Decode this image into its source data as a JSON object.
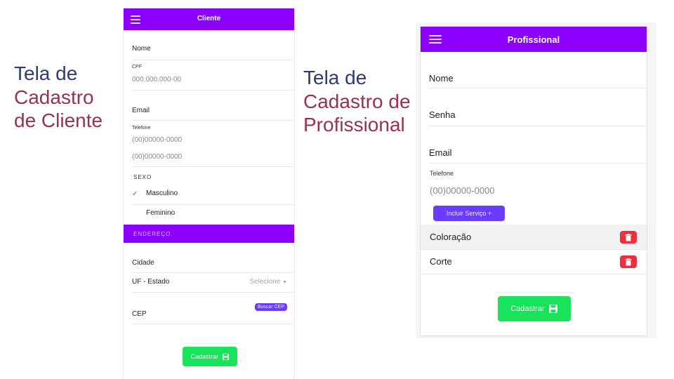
{
  "captions": {
    "cliente": [
      "Tela de",
      "Cadastro",
      "de Cliente"
    ],
    "profissional": [
      "Tela de",
      "Cadastro de",
      "Profissional"
    ]
  },
  "cliente": {
    "title": "Cliente",
    "nome_label": "Nome",
    "cpf_label": "CPF",
    "cpf_placeholder": "000.000.000-00",
    "email_label": "Email",
    "telefone_label": "Telefone",
    "telefone_placeholder_1": "(00)00000-0000",
    "telefone_placeholder_2": "(00)00000-0000",
    "sexo_label": "SEXO",
    "sexo_options": [
      "Masculino",
      "Feminino"
    ],
    "sexo_selected": "Masculino",
    "endereco_label": "ENDEREÇO",
    "cidade_label": "Cidade",
    "uf_label": "UF - Estado",
    "uf_select": "Selecione",
    "cep_label": "CEP",
    "buscar_cep": "Buscar CEP",
    "cadastrar": "Cadastrar"
  },
  "profissional": {
    "title": "Profissional",
    "nome_label": "Nome",
    "senha_label": "Senha",
    "email_label": "Email",
    "telefone_label": "Telefone",
    "telefone_placeholder": "(00)00000-0000",
    "incluir_servico": "Incluir Serviço +",
    "servicos": [
      "Coloração",
      "Corte"
    ],
    "cadastrar": "Cadastrar"
  },
  "colors": {
    "appbar": "#8b00ff",
    "primary_button": "#19e35a",
    "secondary_button": "#6a3cff",
    "delete": "#ef2f3d"
  }
}
